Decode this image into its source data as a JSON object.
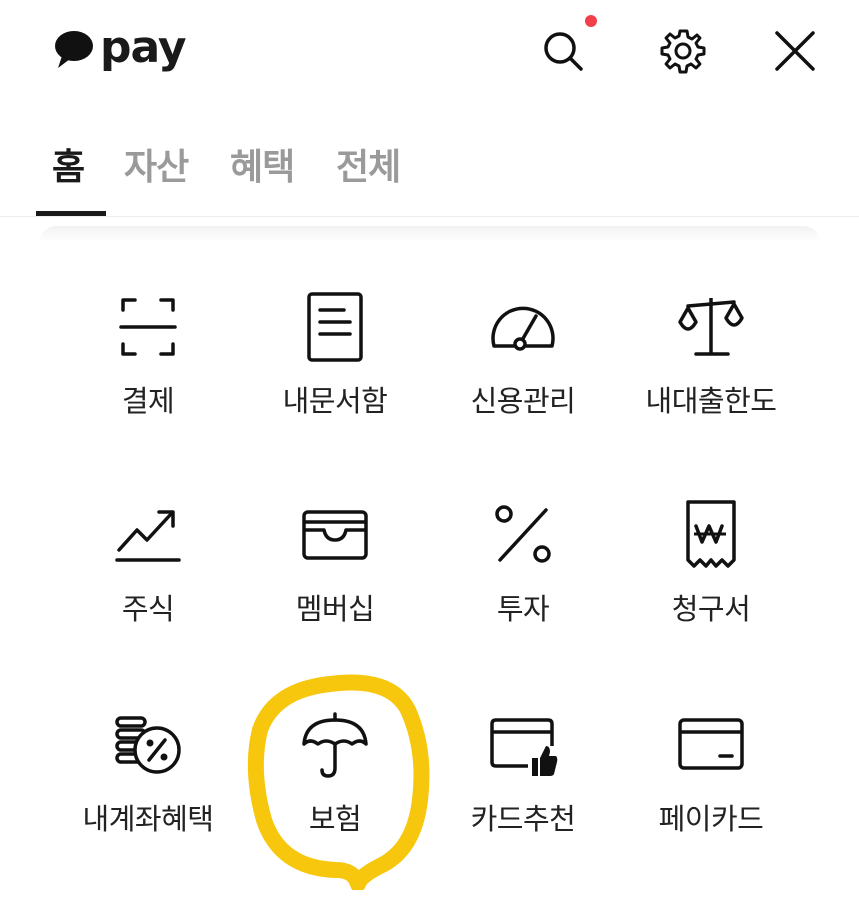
{
  "header": {
    "logo_text": "pay",
    "logo_bubble_icon": "speech-bubble-icon",
    "search_icon": "search-icon",
    "settings_icon": "gear-icon",
    "close_icon": "close-icon",
    "notification_dot_color": "#f2404a"
  },
  "tabs": [
    {
      "label": "홈",
      "active": true
    },
    {
      "label": "자산",
      "active": false
    },
    {
      "label": "혜택",
      "active": false
    },
    {
      "label": "전체",
      "active": false
    }
  ],
  "menu": [
    {
      "label": "결제",
      "icon": "scan-icon"
    },
    {
      "label": "내문서함",
      "icon": "document-icon"
    },
    {
      "label": "신용관리",
      "icon": "gauge-icon"
    },
    {
      "label": "내대출한도",
      "icon": "scale-icon"
    },
    {
      "label": "주식",
      "icon": "trend-up-icon"
    },
    {
      "label": "멤버십",
      "icon": "wallet-icon"
    },
    {
      "label": "투자",
      "icon": "percent-icon"
    },
    {
      "label": "청구서",
      "icon": "receipt-won-icon"
    },
    {
      "label": "내계좌혜택",
      "icon": "coins-percent-icon"
    },
    {
      "label": "보험",
      "icon": "umbrella-icon"
    },
    {
      "label": "카드추천",
      "icon": "card-thumbs-up-icon"
    },
    {
      "label": "페이카드",
      "icon": "card-icon"
    }
  ],
  "highlight_color": "#f5c400"
}
